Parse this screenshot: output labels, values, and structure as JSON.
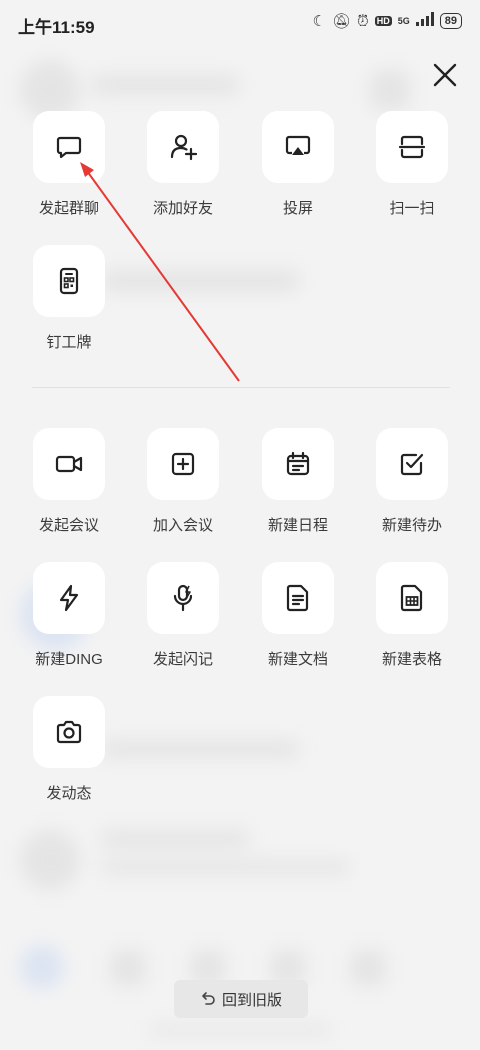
{
  "status_bar": {
    "time": "上午11:59",
    "network": "5G",
    "battery": "89"
  },
  "section_primary": [
    {
      "label": "发起群聊",
      "icon": "chat-bubble-icon"
    },
    {
      "label": "添加好友",
      "icon": "add-person-icon"
    },
    {
      "label": "投屏",
      "icon": "screen-cast-icon"
    },
    {
      "label": "扫一扫",
      "icon": "scan-icon"
    },
    {
      "label": "钉工牌",
      "icon": "badge-icon"
    }
  ],
  "section_secondary": [
    {
      "label": "发起会议",
      "icon": "video-camera-icon"
    },
    {
      "label": "加入会议",
      "icon": "plus-square-icon"
    },
    {
      "label": "新建日程",
      "icon": "calendar-icon"
    },
    {
      "label": "新建待办",
      "icon": "checkbox-icon"
    },
    {
      "label": "新建DING",
      "icon": "lightning-icon"
    },
    {
      "label": "发起闪记",
      "icon": "microphone-icon"
    },
    {
      "label": "新建文档",
      "icon": "document-icon"
    },
    {
      "label": "新建表格",
      "icon": "spreadsheet-icon"
    },
    {
      "label": "发动态",
      "icon": "camera-icon"
    }
  ],
  "footer": {
    "back_to_old": "回到旧版"
  },
  "annotation": {
    "arrow_color": "#e53935"
  }
}
